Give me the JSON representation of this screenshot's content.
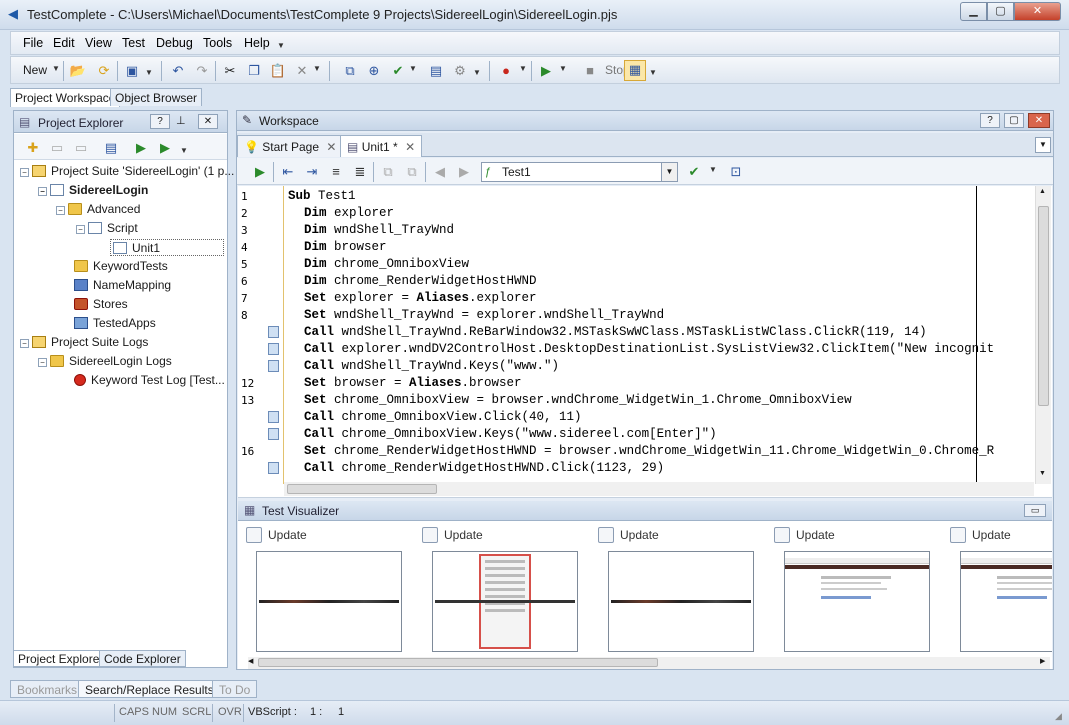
{
  "window": {
    "title": "TestComplete - C:\\Users\\Michael\\Documents\\TestComplete 9 Projects\\SidereelLogin\\SidereelLogin.pjs"
  },
  "menu": [
    "File",
    "Edit",
    "View",
    "Test",
    "Debug",
    "Tools",
    "Help"
  ],
  "toolbar": {
    "new_label": "New",
    "stop_label": "Stop"
  },
  "top_tabs": [
    "Project Workspace",
    "Object Browser"
  ],
  "project_explorer": {
    "title": "Project Explorer",
    "tree": [
      {
        "label": "Project Suite 'SidereelLogin' (1 p...",
        "icon": "suite-icon"
      },
      {
        "label": "SidereelLogin",
        "icon": "project-icon"
      },
      {
        "label": "Advanced",
        "icon": "folder-icon"
      },
      {
        "label": "Script",
        "icon": "script-icon"
      },
      {
        "label": "Unit1",
        "icon": "unit-icon"
      },
      {
        "label": "KeywordTests",
        "icon": "keyword-icon"
      },
      {
        "label": "NameMapping",
        "icon": "namemapping-icon"
      },
      {
        "label": "Stores",
        "icon": "stores-icon"
      },
      {
        "label": "TestedApps",
        "icon": "testedapps-icon"
      },
      {
        "label": "Project Suite Logs",
        "icon": "logs-icon"
      },
      {
        "label": "SidereelLogin Logs",
        "icon": "logs-folder-icon"
      },
      {
        "label": "Keyword Test Log [Test...",
        "icon": "error-icon"
      }
    ],
    "bottom_tabs": [
      "Project Explorer",
      "Code Explorer"
    ]
  },
  "workspace": {
    "title": "Workspace",
    "tabs": [
      "Start Page",
      "Unit1 *"
    ],
    "routine_select": "Test1",
    "code": [
      {
        "n": "1",
        "bp": false,
        "kw": "Sub",
        "rest": " Test1"
      },
      {
        "n": "2",
        "bp": false,
        "kw": "Dim",
        "rest": " explorer"
      },
      {
        "n": "3",
        "bp": false,
        "kw": "Dim",
        "rest": " wndShell_TrayWnd"
      },
      {
        "n": "4",
        "bp": false,
        "kw": "Dim",
        "rest": " browser"
      },
      {
        "n": "5",
        "bp": false,
        "kw": "Dim",
        "rest": " chrome_OmniboxView"
      },
      {
        "n": "6",
        "bp": false,
        "kw": "Dim",
        "rest": " chrome_RenderWidgetHostHWND"
      },
      {
        "n": "7",
        "bp": false,
        "kw": "Set",
        "rest": " explorer = ",
        "kw2": "Aliases",
        "rest2": ".explorer"
      },
      {
        "n": "8",
        "bp": false,
        "kw": "Set",
        "rest": " wndShell_TrayWnd = explorer.wndShell_TrayWnd"
      },
      {
        "n": "",
        "bp": true,
        "kw": "Call",
        "rest": " wndShell_TrayWnd.ReBarWindow32.MSTaskSwWClass.MSTaskListWClass.ClickR(119, 14)"
      },
      {
        "n": "",
        "bp": true,
        "kw": "Call",
        "rest": " explorer.wndDV2ControlHost.DesktopDestinationList.SysListView32.ClickItem(\"New incognit"
      },
      {
        "n": "",
        "bp": true,
        "kw": "Call",
        "rest": " wndShell_TrayWnd.Keys(\"www.\")"
      },
      {
        "n": "12",
        "bp": false,
        "kw": "Set",
        "rest": " browser = ",
        "kw2": "Aliases",
        "rest2": ".browser"
      },
      {
        "n": "13",
        "bp": false,
        "kw": "Set",
        "rest": " chrome_OmniboxView = browser.wndChrome_WidgetWin_1.Chrome_OmniboxView"
      },
      {
        "n": "",
        "bp": true,
        "kw": "Call",
        "rest": " chrome_OmniboxView.Click(40, 11)"
      },
      {
        "n": "",
        "bp": true,
        "kw": "Call",
        "rest": " chrome_OmniboxView.Keys(\"www.sidereel.com[Enter]\")"
      },
      {
        "n": "16",
        "bp": false,
        "kw": "Set",
        "rest": " chrome_RenderWidgetHostHWND = browser.wndChrome_WidgetWin_11.Chrome_WidgetWin_0.Chrome_R"
      },
      {
        "n": "",
        "bp": true,
        "kw": "Call",
        "rest": " chrome_RenderWidgetHostHWND.Click(1123, 29)"
      }
    ]
  },
  "test_visualizer": {
    "title": "Test Visualizer",
    "frames": [
      "Update",
      "Update",
      "Update",
      "Update",
      "Update"
    ]
  },
  "status_tabs": [
    "Bookmarks",
    "Search/Replace Results",
    "To Do"
  ],
  "statusbar": {
    "caps": "CAPS",
    "num": "NUM",
    "scrl": "SCRL",
    "ovr": "OVR",
    "lang": "VBScript :",
    "line": "1 :",
    "col": "1"
  },
  "colors": {
    "accent": "#1f5aa8",
    "chrome": "#d9e4f1",
    "panel_header": "#c7d6e8",
    "close_red": "#c4412a"
  }
}
